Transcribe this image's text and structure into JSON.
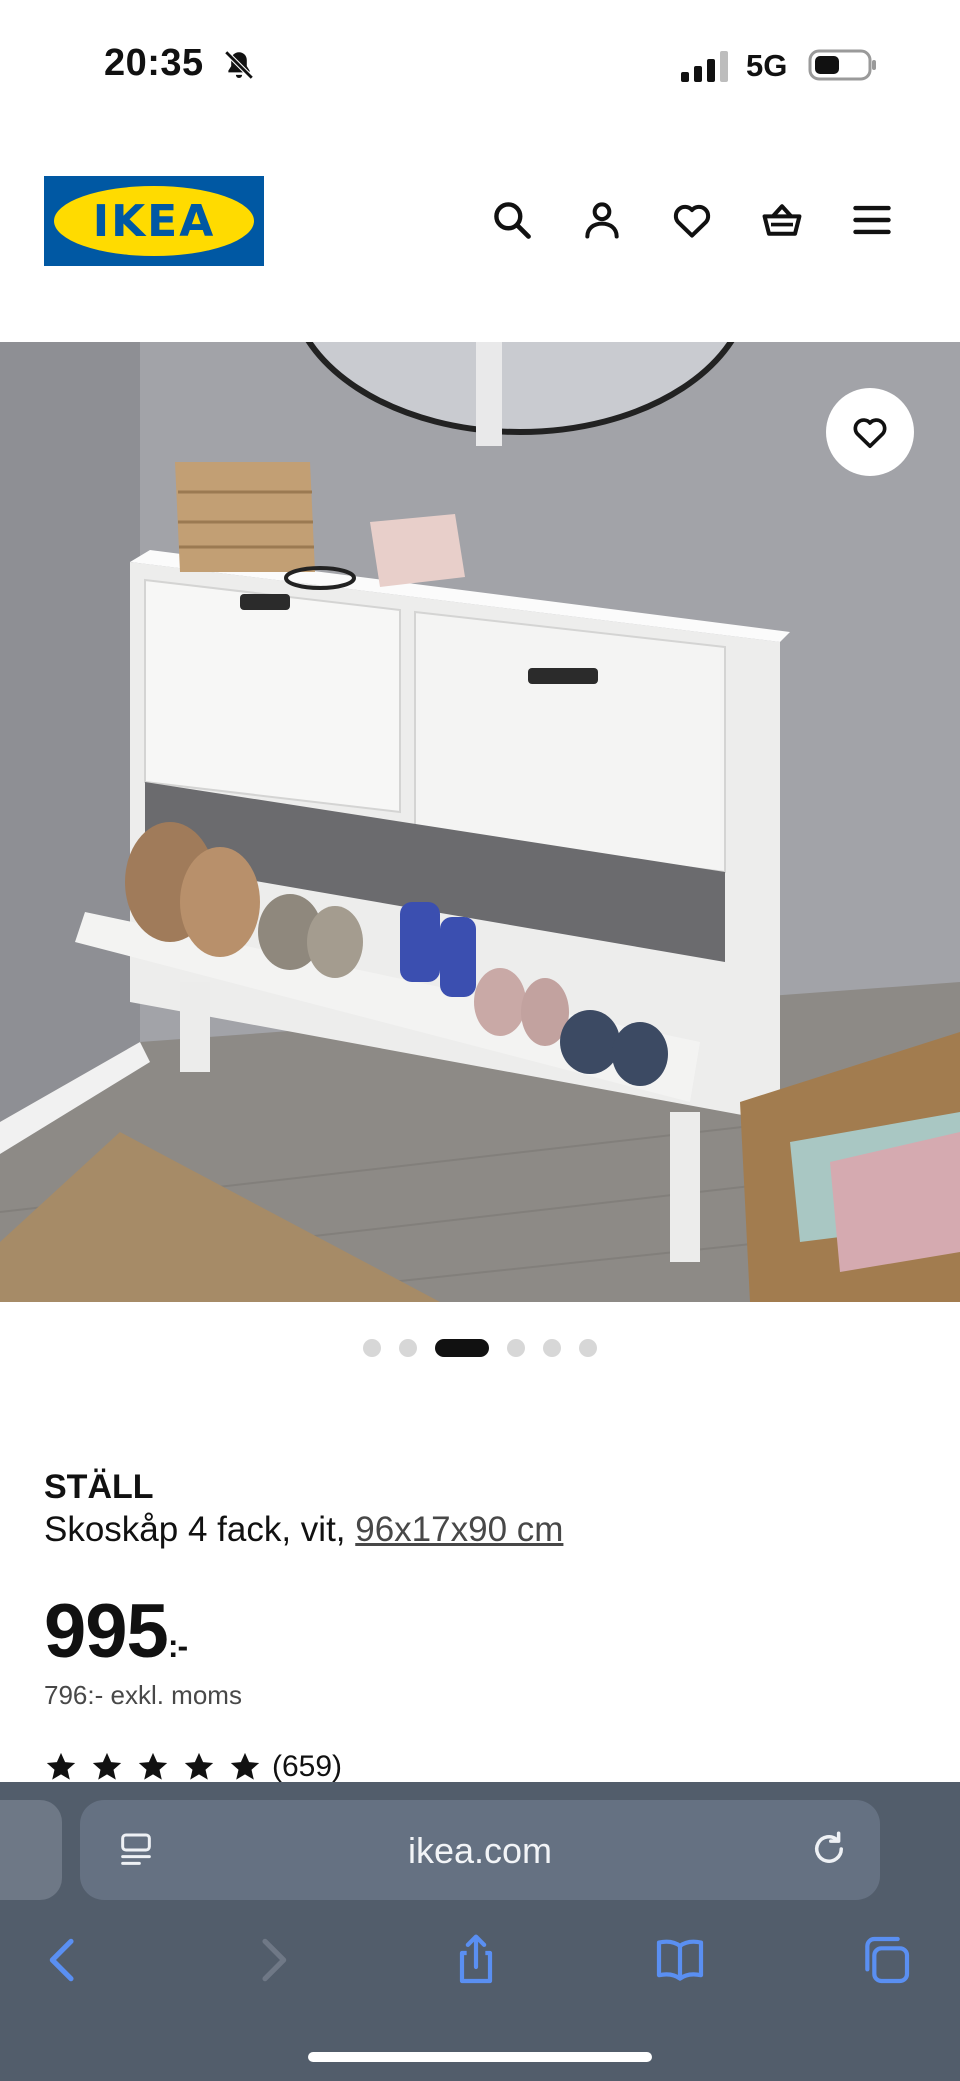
{
  "status_bar": {
    "time": "20:35",
    "network": "5G"
  },
  "header": {
    "logo_text": "IKEA",
    "icons": [
      "search-icon",
      "account-icon",
      "favourites-icon",
      "cart-icon",
      "menu-icon"
    ]
  },
  "carousel": {
    "count": 6,
    "active_index": 2
  },
  "product": {
    "name": "STÄLL",
    "description": "Skoskåp 4 fack, vit, ",
    "dimensions": "96x17x90 cm",
    "price": "995",
    "price_suffix": ":-",
    "price_excl_vat": "796:- exkl. moms",
    "rating": 5,
    "review_count": "(659)"
  },
  "browser": {
    "url": "ikea.com"
  },
  "colors": {
    "ikea_blue": "#0058a3",
    "ikea_yellow": "#ffdb00",
    "browser_bar": "#525d6b",
    "browser_accent": "#5a8ff2"
  }
}
